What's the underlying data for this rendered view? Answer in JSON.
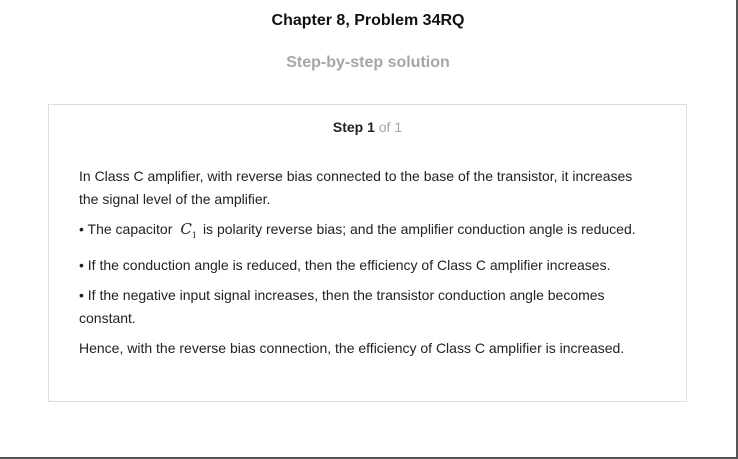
{
  "header": {
    "title": "Chapter 8, Problem 34RQ",
    "subtitle": "Step-by-step solution"
  },
  "step": {
    "label": "Step 1",
    "of": "of 1"
  },
  "solution": {
    "intro": "In Class C amplifier, with reverse bias connected to the base of the transistor, it increases the signal level of the amplifier.",
    "bullet1_pre": "• The capacitor",
    "bullet1_var": "C",
    "bullet1_sub": "1",
    "bullet1_post": "is polarity reverse bias; and the amplifier conduction angle is reduced.",
    "bullet2": "• If the conduction angle is reduced, then the efficiency of Class C amplifier increases.",
    "bullet3": "• If the negative input signal increases, then the transistor conduction angle becomes constant.",
    "conclusion": "Hence, with the reverse bias connection, the efficiency of Class C amplifier is increased."
  },
  "colors": {
    "subtitle": "#a6a6a6",
    "card_border": "#dddddd",
    "frame": "#555555"
  }
}
